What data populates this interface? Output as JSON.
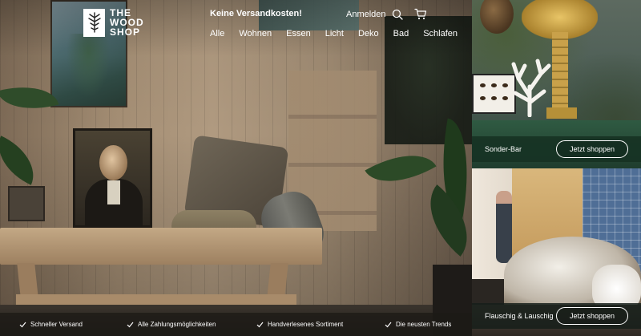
{
  "brand": {
    "name_line1": "THE",
    "name_line2": "WOOD",
    "name_line3": "SHOP"
  },
  "header": {
    "promo": "Keine Versandkosten!",
    "login_label": "Anmelden",
    "search_icon": "search-icon",
    "cart_icon": "cart-icon"
  },
  "nav": {
    "items": [
      {
        "label": "Alle"
      },
      {
        "label": "Wohnen"
      },
      {
        "label": "Essen"
      },
      {
        "label": "Licht"
      },
      {
        "label": "Deko"
      },
      {
        "label": "Bad"
      },
      {
        "label": "Schlafen"
      }
    ]
  },
  "promos": [
    {
      "label": "Sonder-Bar",
      "button": "Jetzt shoppen"
    },
    {
      "label": "Flauschig & Lauschig",
      "button": "Jetzt shoppen"
    }
  ],
  "usps": [
    {
      "label": "Schneller Versand"
    },
    {
      "label": "Alle Zahlungsmöglichkeiten"
    },
    {
      "label": "Handverlesenes Sortiment"
    },
    {
      "label": "Die neusten Trends"
    }
  ],
  "colors": {
    "text": "#ffffff",
    "panel_bar": "#16322a",
    "usp_bar": "#1c1a16"
  }
}
